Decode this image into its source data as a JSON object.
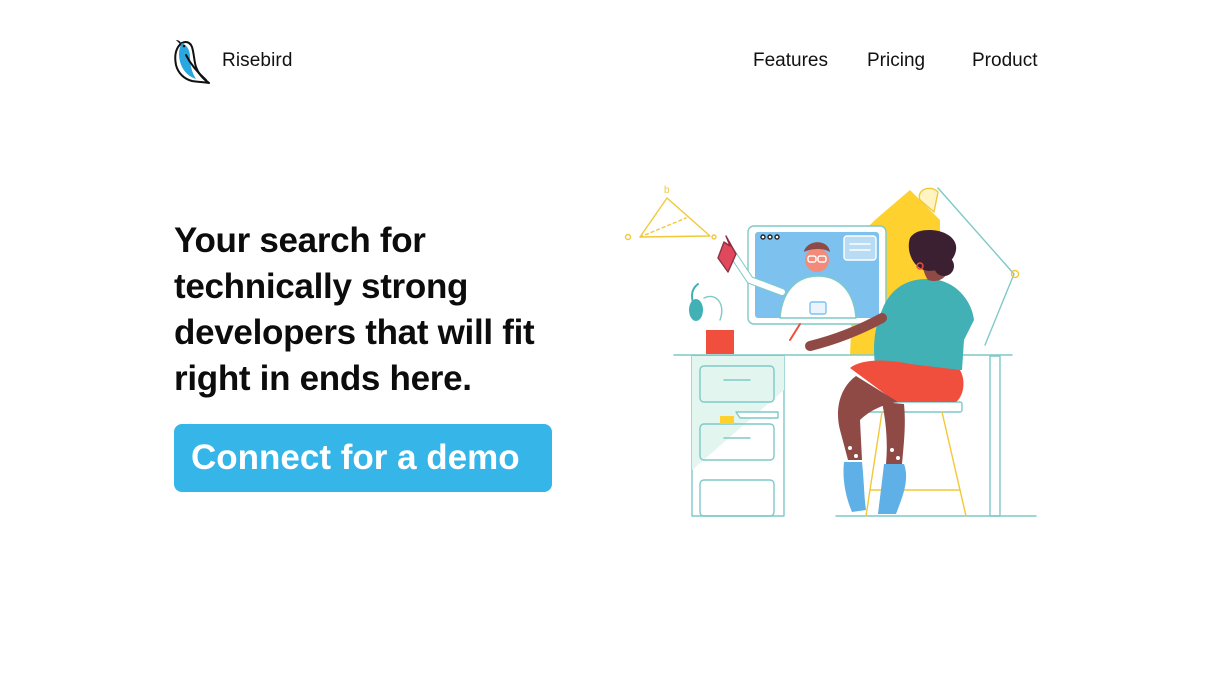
{
  "brand": {
    "name": "Risebird",
    "logo_icon": "bird-logo-icon"
  },
  "nav": {
    "items": [
      {
        "label": "Features"
      },
      {
        "label": "Pricing"
      },
      {
        "label": "Product"
      }
    ]
  },
  "hero": {
    "headline": "Your search for technically strong developers that will fit right in ends here.",
    "cta_label": "Connect for a demo",
    "illustration_labels": {
      "triangle_vertex": "b"
    }
  },
  "colors": {
    "accent": "#35b5e8",
    "illustration_yellow": "#ffd12e",
    "illustration_teal": "#42b1b5",
    "illustration_skin": "#8f4a45",
    "illustration_red": "#ef4f3c",
    "illustration_line": "#7fc9c9"
  }
}
